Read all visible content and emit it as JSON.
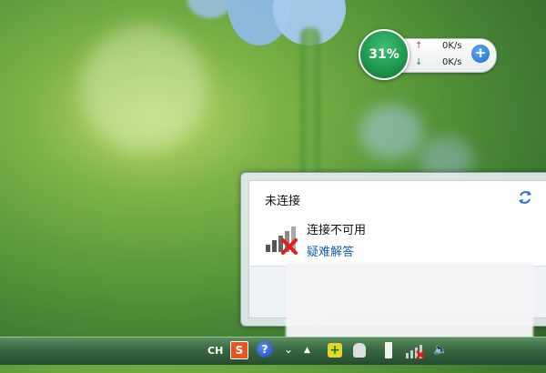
{
  "widget": {
    "percent": "31%",
    "upload_speed": "0K/s",
    "download_speed": "0K/s",
    "up_arrow": "↑",
    "down_arrow": "↓",
    "plus": "+"
  },
  "popup": {
    "title": "未连接",
    "status": "连接不可用",
    "help_link": "疑难解答"
  },
  "taskbar": {
    "language": "CH",
    "sogou_label": "S",
    "help_label": "?"
  },
  "colors": {
    "widget_green": "#1f9a50",
    "link_blue": "#1a5fb4",
    "error_red": "#e0201b"
  }
}
